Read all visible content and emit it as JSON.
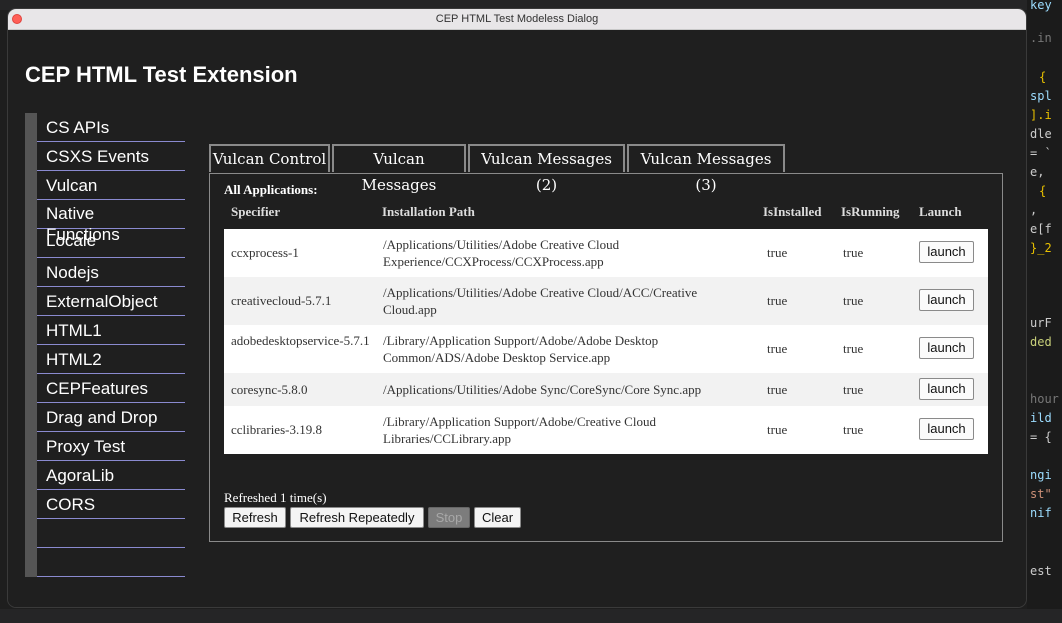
{
  "window": {
    "title": "CEP HTML Test Modeless Dialog"
  },
  "page": {
    "title": "CEP HTML Test Extension"
  },
  "sidebar": {
    "items": [
      "CS APIs",
      "CSXS Events",
      "Vulcan",
      "Native\nFunctions",
      "Locale",
      "Nodejs",
      "ExternalObject",
      "HTML1",
      "HTML2",
      "CEPFeatures",
      "Drag and Drop",
      "Proxy Test",
      "AgoraLib",
      "CORS",
      "",
      ""
    ]
  },
  "tabs": [
    "Vulcan Control",
    "Vulcan Messages",
    "Vulcan Messages (2)",
    "Vulcan Messages (3)"
  ],
  "panel": {
    "section_label": "All Applications:",
    "columns": [
      "Specifier",
      "Installation Path",
      "IsInstalled",
      "IsRunning",
      "Launch"
    ],
    "rows": [
      {
        "specifier": "ccxprocess-1",
        "path": "/Applications/Utilities/Adobe Creative Cloud Experience/CCXProcess/CCXProcess.app",
        "installed": "true",
        "running": "true",
        "launch": "launch"
      },
      {
        "specifier": "creativecloud-5.7.1",
        "path": "/Applications/Utilities/Adobe Creative Cloud/ACC/Creative Cloud.app",
        "installed": "true",
        "running": "true",
        "launch": "launch"
      },
      {
        "specifier": "adobedesktopservice-5.7.1",
        "path": "/Library/Application Support/Adobe/Adobe Desktop Common/ADS/Adobe Desktop Service.app",
        "installed": "true",
        "running": "true",
        "launch": "launch"
      },
      {
        "specifier": "coresync-5.8.0",
        "path": "/Applications/Utilities/Adobe Sync/CoreSync/Core Sync.app",
        "installed": "true",
        "running": "true",
        "launch": "launch"
      },
      {
        "specifier": "cclibraries-3.19.8",
        "path": "/Library/Application Support/Adobe/Creative Cloud Libraries/CCLibrary.app",
        "installed": "true",
        "running": "true",
        "launch": "launch"
      }
    ],
    "refresh_status": "Refreshed 1 time(s)",
    "buttons": {
      "refresh": "Refresh",
      "refresh_repeatedly": "Refresh Repeatedly",
      "stop": "Stop",
      "clear": "Clear"
    }
  },
  "background_code": [
    "key",
    ".in",
    "{",
    "spl",
    "].i",
    "dle",
    "= `",
    "e,",
    "{",
    ",",
    "e[f",
    "}_2",
    "urF",
    "ded",
    "hour",
    "ild",
    "= {",
    "ngi",
    "st\"",
    "nif",
    "est"
  ]
}
